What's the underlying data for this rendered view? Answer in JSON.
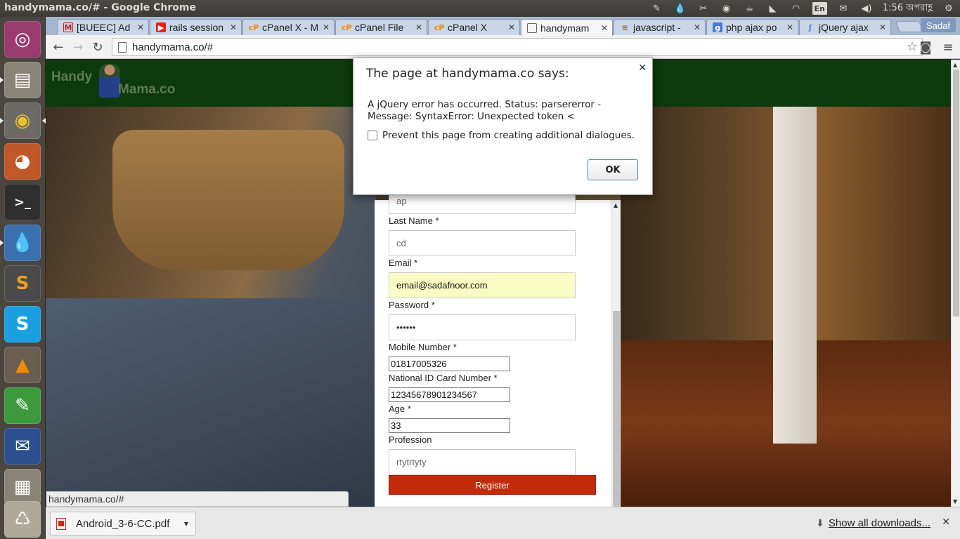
{
  "window": {
    "title": "handymama.co/# - Google Chrome"
  },
  "tray": {
    "lang": "En",
    "clock": "1:56 অপরাহ্ণ"
  },
  "tabs": [
    {
      "label": "[BUEEC] Ad",
      "icon": "gmail-icon"
    },
    {
      "label": "rails session",
      "icon": "youtube-icon"
    },
    {
      "label": "cPanel X - M",
      "icon": "cpanel-icon"
    },
    {
      "label": "cPanel File",
      "icon": "cpanel-icon"
    },
    {
      "label": "cPanel X",
      "icon": "cpanel-icon"
    },
    {
      "label": "handymam",
      "icon": "page-icon",
      "active": true
    },
    {
      "label": "javascript -",
      "icon": "stackoverflow-icon"
    },
    {
      "label": "php ajax po",
      "icon": "google-icon"
    },
    {
      "label": "jQuery ajax",
      "icon": "jquery-icon"
    }
  ],
  "profile": "Sadaf",
  "omnibox": {
    "url": "handymama.co/#"
  },
  "site": {
    "logo_top": "Handy",
    "logo_bottom": "Mama.co"
  },
  "form": {
    "first_name_value": "ap",
    "last_name_label": "Last Name *",
    "last_name_value": "cd",
    "email_label": "Email *",
    "email_value": "email@sadafnoor.com",
    "password_label": "Password *",
    "password_value": "••••••",
    "mobile_label": "Mobile Number *",
    "mobile_value": "01817005326",
    "nid_label": "National ID Card Number *",
    "nid_value": "12345678901234567",
    "age_label": "Age *",
    "age_value": "33",
    "profession_label": "Profession",
    "profession_value": "rtytrtyty",
    "register_label": "Register"
  },
  "dialog": {
    "title": "The page at handymama.co says:",
    "message": "A jQuery error has occurred. Status: parsererror - Message: SyntaxError: Unexpected token <",
    "checkbox_label": "Prevent this page from creating additional dialogues.",
    "ok_label": "OK"
  },
  "status_url": "handymama.co/#",
  "downloads": {
    "file_name": "Android_3-6-CC.pdf",
    "show_all_label": "Show all downloads..."
  },
  "colors": {
    "header_green": "#0c3a0c",
    "register_red": "#c22a0b",
    "autofill_yellow": "#fafcc6"
  }
}
